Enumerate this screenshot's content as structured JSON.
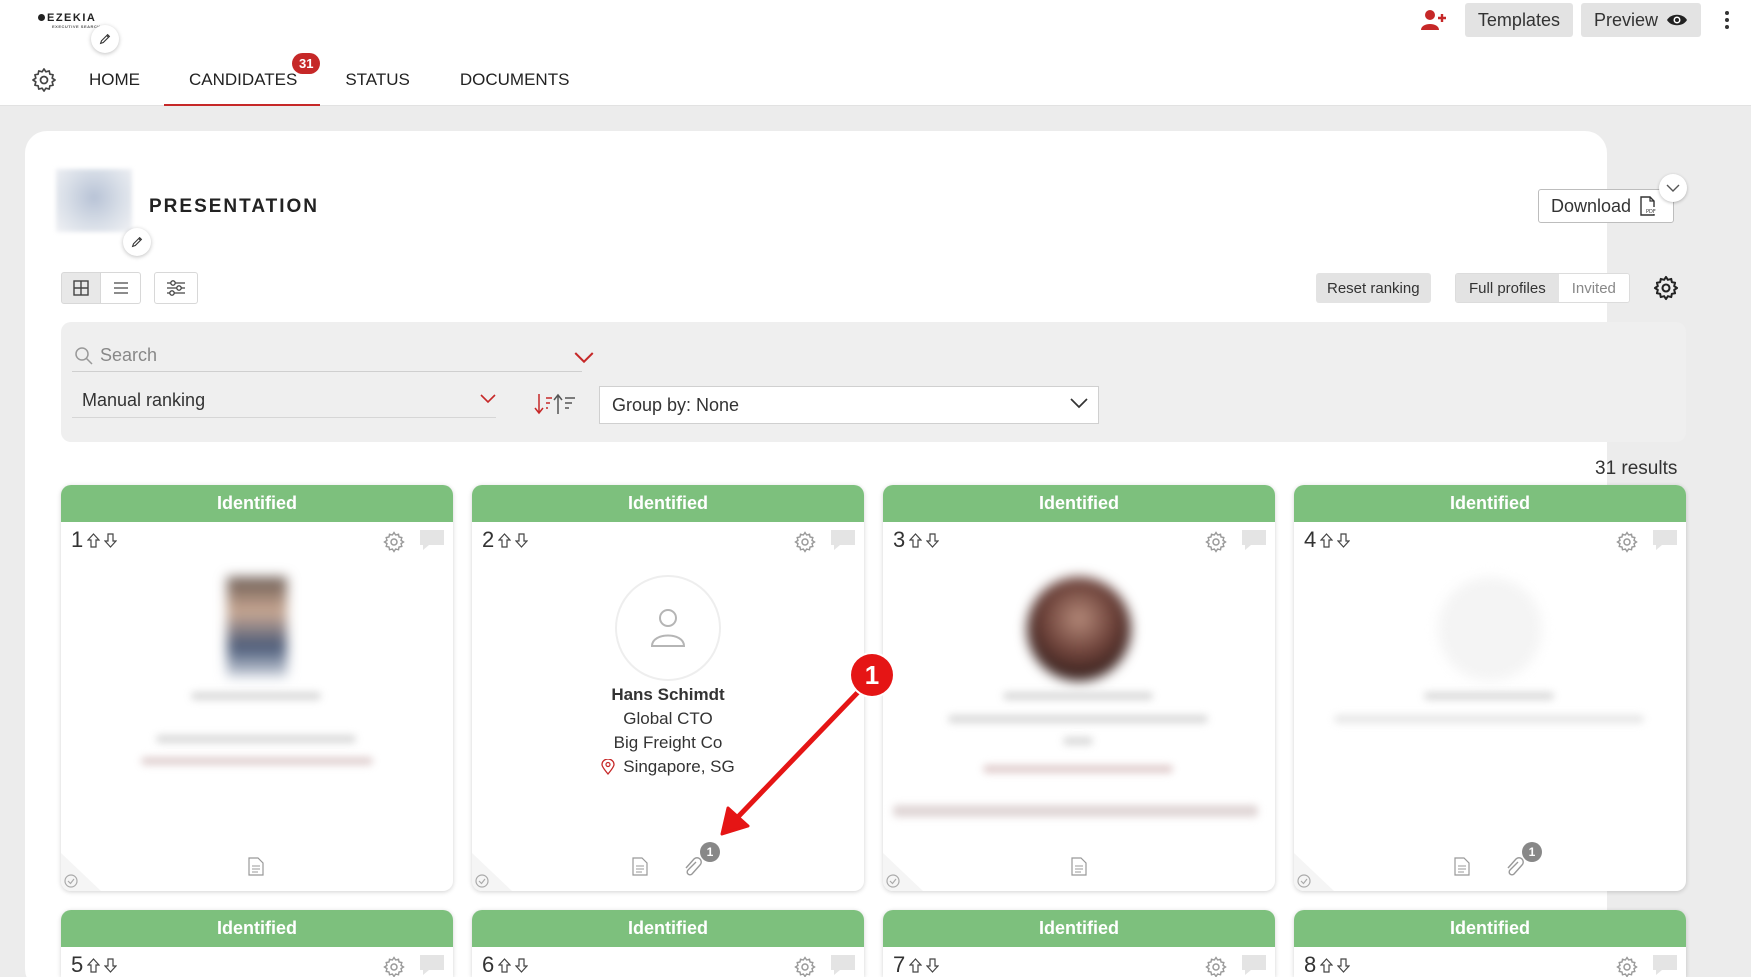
{
  "header": {
    "logo_text": "EZEKIA",
    "logo_sub": "EXECUTIVE SEARCH",
    "tabs": [
      {
        "label": "HOME",
        "active": false
      },
      {
        "label": "CANDIDATES",
        "active": true,
        "badge": "31"
      },
      {
        "label": "STATUS",
        "active": false
      },
      {
        "label": "DOCUMENTS",
        "active": false
      }
    ],
    "templates_label": "Templates",
    "preview_label": "Preview"
  },
  "presentation": {
    "title": "PRESENTATION",
    "download_label": "Download",
    "reset_ranking_label": "Reset ranking",
    "full_profiles_label": "Full profiles",
    "invited_label": "Invited"
  },
  "filters": {
    "search_placeholder": "Search",
    "sort_value": "Manual ranking",
    "group_by_value": "Group by: None"
  },
  "results_text": "31 results",
  "cards": [
    {
      "rank": "1",
      "status": "Identified"
    },
    {
      "rank": "2",
      "status": "Identified",
      "name": "Hans Schimdt",
      "title": "Global CTO",
      "company": "Big Freight Co",
      "location": "Singapore, SG",
      "attachments": "1"
    },
    {
      "rank": "3",
      "status": "Identified"
    },
    {
      "rank": "4",
      "status": "Identified",
      "attachments": "1"
    },
    {
      "rank": "5",
      "status": "Identified"
    },
    {
      "rank": "6",
      "status": "Identified"
    },
    {
      "rank": "7",
      "status": "Identified"
    },
    {
      "rank": "8",
      "status": "Identified"
    }
  ],
  "annotation": {
    "number": "1"
  },
  "colors": {
    "accent": "#c62828",
    "status_green": "#7dc07d",
    "annotation_red": "#e51515"
  }
}
